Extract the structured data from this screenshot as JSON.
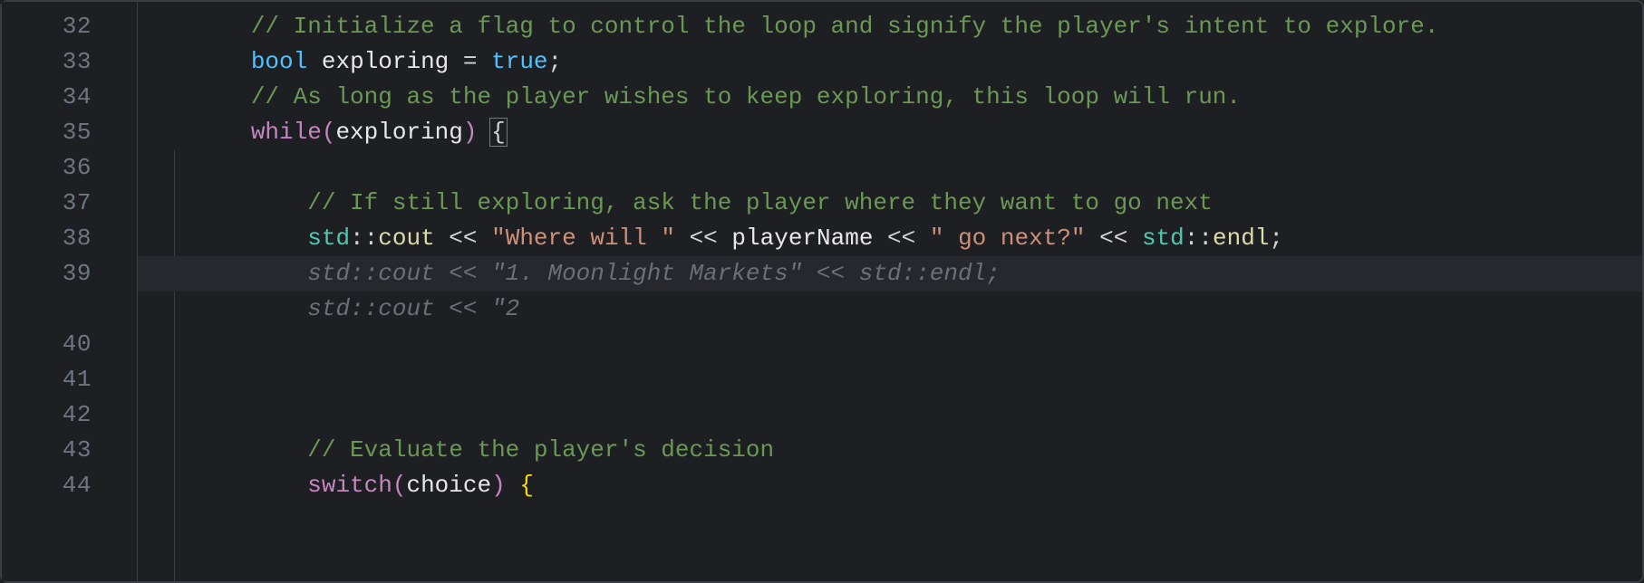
{
  "gutter": {
    "lines": [
      "32",
      "33",
      "34",
      "35",
      "36",
      "37",
      "38",
      "39",
      "",
      "40",
      "41",
      "42",
      "43",
      "44"
    ]
  },
  "code": {
    "l32": {
      "indent": "        ",
      "comment": "// Initialize a flag to control the loop and signify the player's intent to explore."
    },
    "l33": {
      "indent": "        ",
      "kw": "bool",
      "sp1": " ",
      "ident": "exploring",
      "sp2": " ",
      "eq": "=",
      "sp3": " ",
      "val": "true",
      "semi": ";"
    },
    "l34": {
      "indent": "        ",
      "comment": "// As long as the player wishes to keep exploring, this loop will run."
    },
    "l35": {
      "indent": "        ",
      "kw": "while",
      "lp": "(",
      "ident": "exploring",
      "rp": ")",
      "sp": " ",
      "brace": "{"
    },
    "l36": {
      "indent": ""
    },
    "l37": {
      "indent": "            ",
      "comment": "// If still exploring, ask the player where they want to go next"
    },
    "l38": {
      "indent": "            ",
      "ns": "std",
      "cc1": "::",
      "cout": "cout",
      "sp1": " ",
      "op1": "<<",
      "sp2": " ",
      "str1": "\"Where will \"",
      "sp3": " ",
      "op2": "<<",
      "sp4": " ",
      "var": "playerName",
      "sp5": " ",
      "op3": "<<",
      "sp6": " ",
      "str2": "\" go next?\"",
      "sp7": " ",
      "op4": "<<",
      "sp8": " ",
      "ns2": "std",
      "cc2": "::",
      "endl": "endl",
      "semi": ";"
    },
    "l39": {
      "indent": "            ",
      "ghost1": "std::cout << \"1. Moonlight Markets\" << std::endl;"
    },
    "l39b": {
      "indent": "            ",
      "ghost2": "std::cout << \"2"
    },
    "l40": {
      "indent": ""
    },
    "l41": {
      "indent": ""
    },
    "l42": {
      "indent": ""
    },
    "l43": {
      "indent": "            ",
      "comment": "// Evaluate the player's decision"
    },
    "l44": {
      "indent": "            ",
      "kw": "switch",
      "lp": "(",
      "ident": "choice",
      "rp": ")",
      "sp": " ",
      "brace": "{"
    }
  }
}
